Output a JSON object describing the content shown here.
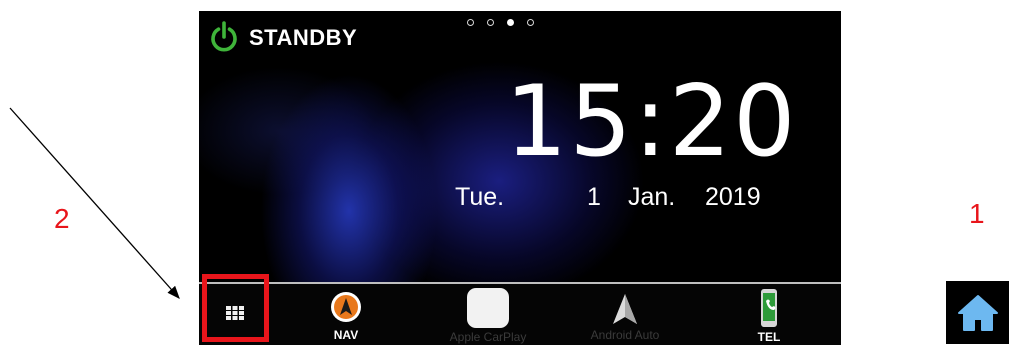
{
  "annotations": {
    "label_2": "2",
    "label_1": "1",
    "marker_color": "#e8151b"
  },
  "status": {
    "standby_label": "STANDBY",
    "power_icon": "power-icon",
    "power_icon_color": "#3fb43a",
    "page_dots": {
      "count": 4,
      "active_index": 2
    }
  },
  "clock": {
    "time": "15:20",
    "day": "Tue.",
    "date": "1",
    "month": "Jan.",
    "year": "2019"
  },
  "dock": {
    "items": [
      {
        "id": "apps",
        "label": "",
        "icon": "apps-grid-icon",
        "highlighted": true
      },
      {
        "id": "nav",
        "label": "NAV",
        "icon": "navigation-icon"
      },
      {
        "id": "carplay",
        "label": "Apple CarPlay",
        "icon": "carplay-icon"
      },
      {
        "id": "android",
        "label": "Android Auto",
        "icon": "android-auto-icon"
      },
      {
        "id": "tel",
        "label": "TEL",
        "icon": "phone-icon"
      }
    ]
  },
  "home_button": {
    "icon": "home-icon",
    "color": "#6db8f0"
  }
}
